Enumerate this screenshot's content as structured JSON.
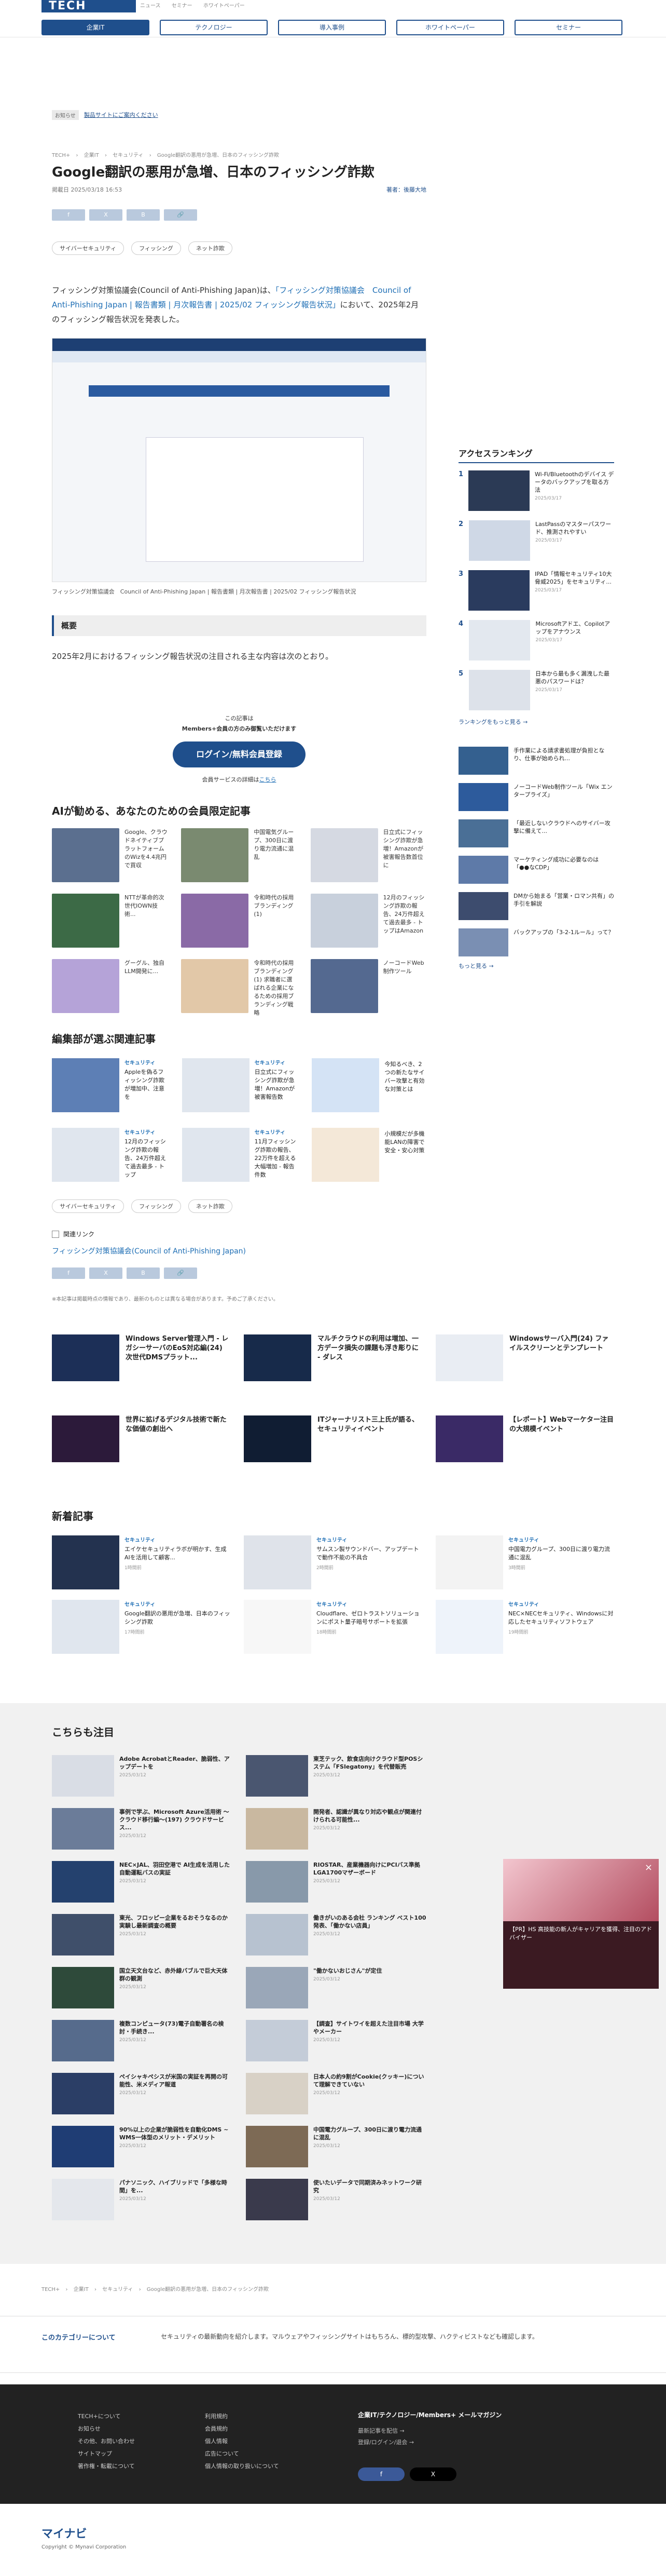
{
  "header": {
    "logo": "TECH",
    "top_links": [
      "ニュース",
      "セミナー",
      "ホワイトペーパー"
    ],
    "categories": [
      "企業IT",
      "テクノロジー",
      "導入事例",
      "ホワイトペーパー",
      "セミナー"
    ]
  },
  "pr": {
    "badge": "お知らせ",
    "link": "製品サイトにご案内ください"
  },
  "breadcrumb": [
    "TECH+",
    "企業IT",
    "セキュリティ",
    "Google翻訳の悪用が急増、日本のフィッシング詐欺"
  ],
  "article": {
    "title": "Google翻訳の悪用が急増、日本のフィッシング詐欺",
    "date": "掲載日 2025/03/18 16:53",
    "author": "著者：後藤大地",
    "share": [
      "f",
      "X",
      "B",
      "🔗"
    ],
    "tags": [
      "サイバーセキュリティ",
      "フィッシング",
      "ネット詐欺"
    ],
    "para1_a": "フィッシング対策協議会(Council of Anti-Phishing Japan)は、",
    "para1_link": "「フィッシング対策協議会　Council of Anti-Phishing Japan | 報告書類 | 月次報告書 | 2025/02 フィッシング報告状況」",
    "para1_b": "において、2025年2月のフィッシング報告状況を発表した。",
    "caption": "フィッシング対策協議会　Council of Anti-Phishing Japan | 報告書類 | 月次報告書 | 2025/02 フィッシング報告状況",
    "section_head": "概要",
    "para2": "2025年2月におけるフィッシング報告状況の注目される主な内容は次のとおり。"
  },
  "gate": {
    "line1": "この記事は",
    "line2": "Members+会員の方のみ御覧いただけます",
    "button": "ログイン/無料会員登録",
    "sub_a": "会員サービスの詳細は",
    "sub_link": "こちら"
  },
  "ai": {
    "heading": "AIが勧める、あなたのための会員限定記事",
    "items": [
      "Google、クラウドネイティブプラットフォームのWizを4.4兆円で買収",
      "中国電気グループ、300日に渡り電力流通に混乱",
      "ノーコードWeb制作ツール",
      "日立式にフィッシング詐欺が急増！Amazonが被害報告数首位に",
      "NTTが革命的次世代IOWN技術...",
      "令和時代の採用ブランディング(1)",
      "12月のフィッシング詐欺の報告、24万件超えて過去最多 - トップはAmazon",
      "グーグル、独自LLM開発に...",
      "令和時代の採用ブランディング(1) 求職者に選ばれる企業になるための採用ブランディング戦略"
    ]
  },
  "related": {
    "heading": "編集部が選ぶ関連記事",
    "items": [
      {
        "cat": "セキュリティ",
        "t": "Appleを偽るフィッシング詐欺が増加中、注意を"
      },
      {
        "cat": "セキュリティ",
        "t": "日立式にフィッシング詐欺が急増！Amazonが被害報告数"
      },
      {
        "cat": "",
        "t": "今知るべき、2つの新たなサイバー攻撃と有効な対策とは"
      },
      {
        "cat": "セキュリティ",
        "t": "12月のフィッシング詐欺の報告、24万件超えて過去最多 - トップ"
      },
      {
        "cat": "セキュリティ",
        "t": "11月フィッシング詐欺の報告、22万件を超える 大幅増加 - 報告件数"
      },
      {
        "cat": "",
        "t": "小規模だが多機能LANの障害で安全・安心対策"
      }
    ]
  },
  "bottom_tags": [
    "サイバーセキュリティ",
    "フィッシング",
    "ネット詐欺"
  ],
  "related_link_label": "関連リンク",
  "related_link": "フィッシング対策協議会(Council of Anti-Phishing Japan)",
  "notice": "※本記事は掲載時点の情報であり、最新のものとは異なる場合があります。予めご了承ください。",
  "biz": [
    "Windows Server管理入門 - レガシーサーバのEoS対応編(24) 次世代DMSプラット...",
    "マルチクラウドの利用は増加、一方データ損失の課題も浮き彫りに - ダレス",
    "Windowsサーバ入門(24) ファイルスクリーンとテンプレート",
    "世界に拡げるデジタル技術で新たな価値の創出へ",
    "ITジャーナリスト三上氏が語る、セキュリティイベント",
    "【レポート】Webマーケター注目の大規模イベント"
  ],
  "new_articles": {
    "heading": "新着記事",
    "items": [
      {
        "cat": "セキュリティ",
        "t": "エイケセキュリティラボが明かす、生成AIを活用して顧客...",
        "d": "1時間前"
      },
      {
        "cat": "セキュリティ",
        "t": "サムスン製サウンドバー、アップデートで動作不能の不具合",
        "d": "2時間前"
      },
      {
        "cat": "セキュリティ",
        "t": "中国電力グループ、300日に渡り電力流通に混乱",
        "d": "3時間前"
      },
      {
        "cat": "セキュリティ",
        "t": "Google翻訳の悪用が急増、日本のフィッシング詐欺",
        "d": "17時間前"
      },
      {
        "cat": "セキュリティ",
        "t": "Cloudflare、ゼロトラストソリューションにポスト量子暗号サポートを拡張",
        "d": "18時間前"
      },
      {
        "cat": "セキュリティ",
        "t": "NEC×NECセキュリティ、Windowsに対応したセキュリティソフトウェア",
        "d": "19時間前"
      }
    ]
  },
  "focus": {
    "heading": "こちらも注目",
    "items": [
      {
        "t": "Adobe AcrobatとReader、脆弱性、アップデートを",
        "d": "2025/03/12"
      },
      {
        "t": "東芝テック、飲食店向けクラウド型POSシステム「FSlegatony」を代替販売",
        "d": "2025/03/12"
      },
      {
        "t": "事例で学ぶ、Microsoft Azure活用術 ～クラウド移行編～(197) クラウドサービス...",
        "d": "2025/03/12"
      },
      {
        "t": "開発者、認識が異なり対応や観点が関連付けられる可能性...",
        "d": "2025/03/12"
      },
      {
        "t": "NEC×JAL、羽田空港で AI生成を活用した自動運転バスの実証",
        "d": "2025/03/12"
      },
      {
        "t": "RIOSTAR、産業機器向けにPCIバス準拠LGA1700マザーボード",
        "d": "2025/03/12"
      },
      {
        "t": "東光、フロッピー企業をるおそうなるのか実験し最新調査の概要",
        "d": "2025/03/12"
      },
      {
        "t": "働きがいのある会社 ランキング ベスト100発表、「働かない店員」",
        "d": "2025/03/12"
      },
      {
        "t": "国立天文台など、赤外線バブルで巨大天体群の観測",
        "d": "2025/03/12"
      },
      {
        "t": "\"働かないおじさん\"が定住",
        "d": "2025/03/12"
      },
      {
        "t": "複数コンピュータ(73)電子自動署名の検討・手続き...",
        "d": "2025/03/12"
      },
      {
        "t": "【調査】サイトワイを超えた注目市場 大学やメーカー",
        "d": "2025/03/12"
      },
      {
        "t": "ペイシャキペシスが米国の実証を再開の可能性、米メディア報道",
        "d": "2025/03/12"
      },
      {
        "t": "日本人の約9割がCookie(クッキー)について理解できていない",
        "d": "2025/03/12"
      },
      {
        "t": "90%以上の企業が脆弱性を自動化DMS ~ WMS一体型のメリット・デメリット",
        "d": "2025/03/12"
      },
      {
        "t": "中国電力グループ、300日に渡り電力流通に混乱",
        "d": "2025/03/12"
      },
      {
        "t": "パナソニック、ハイブリッドで「多様な時間」を...",
        "d": "2025/03/12"
      },
      {
        "t": "使いたいデータで同期済みネットワーク研究",
        "d": "2025/03/12"
      }
    ]
  },
  "ad": {
    "close": "×",
    "text": "【PR】HS 高技能の新人がキャリアを獲得、注目のアドバイザー"
  },
  "ranking": {
    "heading": "アクセスランキング",
    "items": [
      {
        "t": "Wi-Fi/Bluetoothのデバイス データのバックアップを取る方法",
        "d": "2025/03/17"
      },
      {
        "t": "LastPassのマスターパスワード、推測されやすい",
        "d": "2025/03/17"
      },
      {
        "t": "IPAD「情報セキュリティ10大脅威2025」をセキュリティ...",
        "d": "2025/03/17"
      },
      {
        "t": "Microsoftアドエ、Copilotアップをアナウンス",
        "d": "2025/03/17"
      },
      {
        "t": "日本から最も多く漏洩した最悪のパスワードは？",
        "d": "2025/03/17"
      }
    ],
    "more": "ランキングをもっと見る →"
  },
  "side_pr": {
    "items": [
      "手作業による請求書処理が負担となり、仕事が始められ...",
      "ノーコードWeb制作ツール「Wix エンタープライズ」",
      "「最近しないクラウドへのサイバー攻撃に備えて...",
      "マーケティング成功に必要なのは「●●なCDP」",
      "DMから始まる「営業・ロマン共有」の手引を解説",
      "バックアップの「3-2-1ルール」って？"
    ],
    "more": "もっと見る →"
  },
  "breadcrumb_bottom": [
    "TECH+",
    "企業IT",
    "セキュリティ",
    "Google翻訳の悪用が急増、日本のフィッシング詐欺"
  ],
  "about": {
    "title": "このカテゴリーについて",
    "desc": "セキュリティの最新動向を紹介します。マルウェアやフィッシングサイトはもちろん、標的型攻撃、ハクティビストなども確認します。"
  },
  "footer": {
    "col1": [
      "TECH+について",
      "お知らせ",
      "その他、お問い合わせ",
      "サイトマップ",
      "著作権・転載について"
    ],
    "col2": [
      "利用規約",
      "会員規約",
      "個人情報",
      "広告について",
      "個人情報の取り扱いについて"
    ],
    "member_title": "企業IT/テクノロジー/Members+ メールマガジン",
    "member_sub": [
      "最新記事を配信 →",
      "登録/ログイン/退会 →"
    ],
    "buttons": [
      "f",
      "X"
    ]
  },
  "brand": {
    "logo": "マイナビ",
    "copy": "Copyright © Mynavi Corporation"
  }
}
